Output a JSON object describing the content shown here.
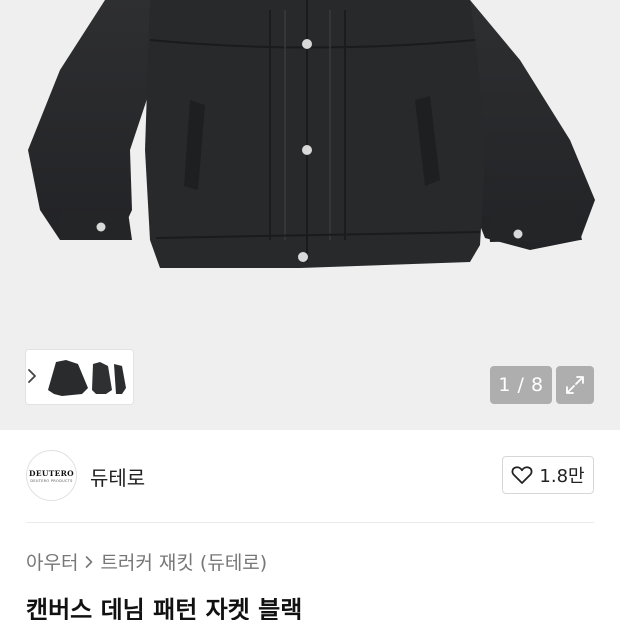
{
  "gallery": {
    "current": "1",
    "total": "8",
    "counter_text": "1 / 8",
    "icons": {
      "expand": "expand-icon",
      "next": "chevron-right-icon"
    }
  },
  "brand": {
    "logo_text": "DEUTERO",
    "logo_subtext": "DEUTERO PRODUCTS",
    "name": "듀테로",
    "like_count": "1.8만",
    "icons": {
      "like": "heart-outline-icon"
    }
  },
  "breadcrumb": {
    "items": [
      "아우터",
      "트러커 재킷 (듀테로)"
    ]
  },
  "product": {
    "title": "캔버스 데님 패턴 자켓 블랙"
  },
  "colors": {
    "hero_background": "#efefef",
    "jacket": "#2a2b2d",
    "overlay": "#787878"
  }
}
